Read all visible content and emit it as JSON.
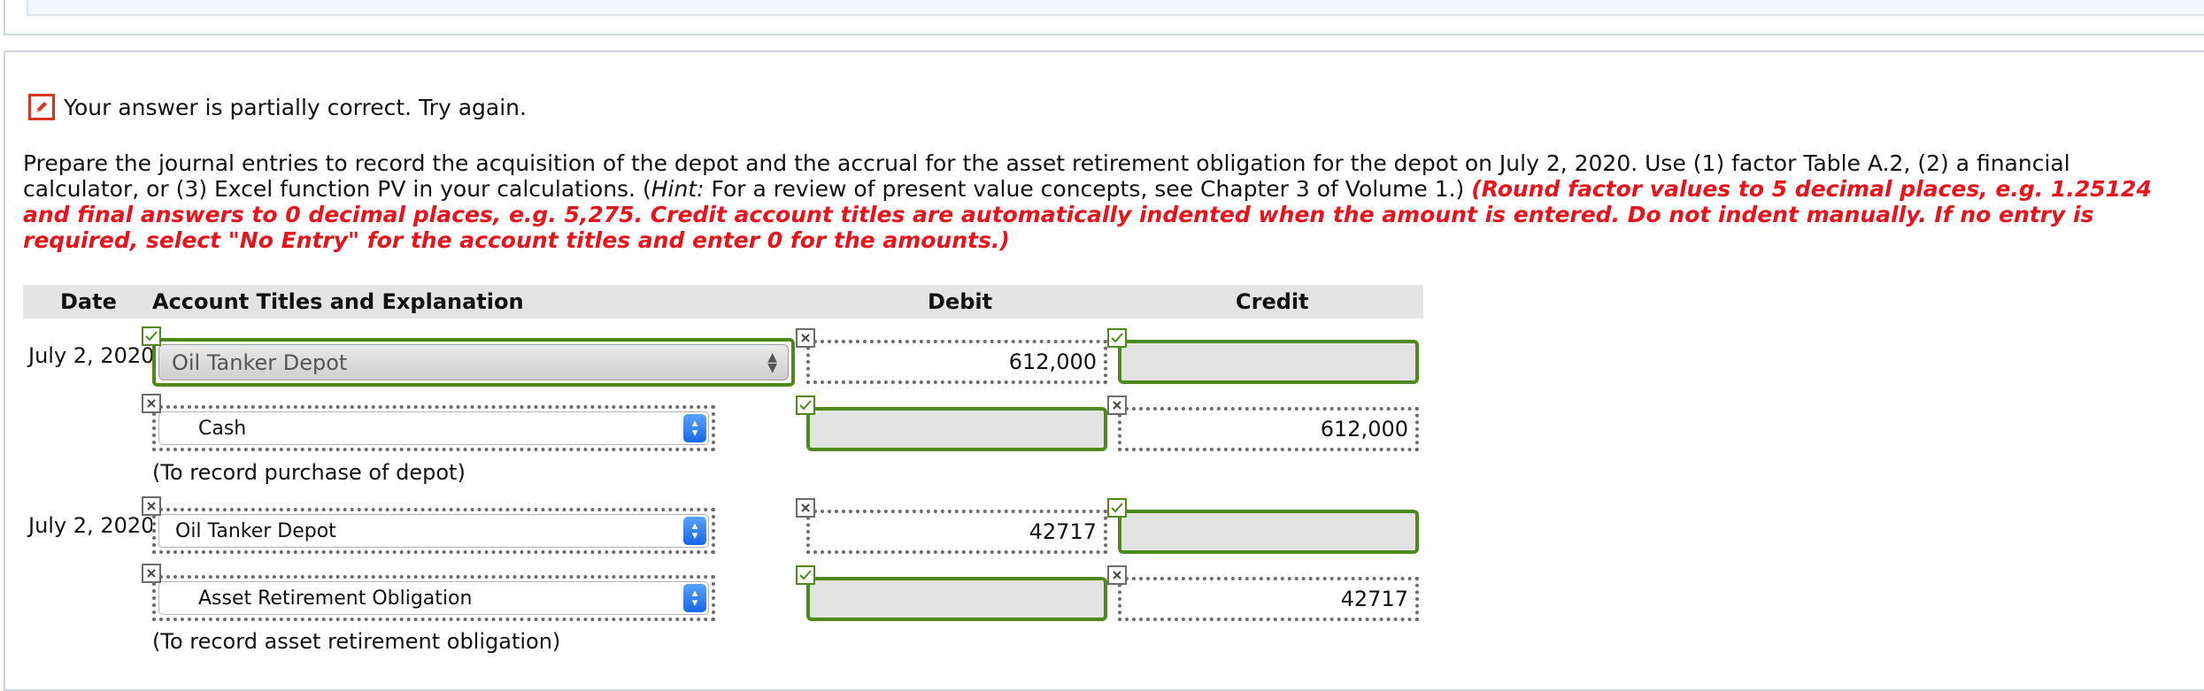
{
  "feedback": {
    "status_text": "Your answer is partially correct.  Try again."
  },
  "instructions": {
    "part1": "Prepare the journal entries to record the acquisition of the depot and the accrual for the asset retirement obligation for the depot on July 2, 2020. Use (1) factor Table A.2, (2) a financial calculator, or (3) Excel function PV in your calculations. (",
    "hint_label": "Hint:",
    "part2": " For a review of present value concepts, see Chapter 3 of Volume 1.) ",
    "red_text": "(Round factor values to 5 decimal places, e.g. 1.25124 and final answers to 0 decimal places, e.g. 5,275. Credit account titles are automatically indented when the amount is entered. Do not indent manually. If no entry is required, select \"No Entry\" for the account titles and enter 0 for the amounts.)"
  },
  "table": {
    "headers": {
      "date": "Date",
      "account": "Account Titles and Explanation",
      "debit": "Debit",
      "credit": "Credit"
    },
    "entries": [
      {
        "date": "July 2, 2020",
        "lines": [
          {
            "account": "Oil Tanker Depot",
            "debit": "612,000",
            "credit": ""
          },
          {
            "account": "Cash",
            "debit": "",
            "credit": "612,000"
          }
        ],
        "memo": "(To record purchase of depot)"
      },
      {
        "date": "July 2, 2020",
        "lines": [
          {
            "account": "Oil Tanker Depot",
            "debit": "42717",
            "credit": ""
          },
          {
            "account": "Asset Retirement Obligation",
            "debit": "",
            "credit": "42717"
          }
        ],
        "memo": "(To record asset retirement obligation)"
      }
    ]
  },
  "colors": {
    "correct": "#4e8a1b",
    "incorrect": "#6b6b6b",
    "emphasis_red": "#e8141c",
    "feedback_icon": "#d9331f"
  },
  "icons": {
    "feedback": "pencil-icon",
    "correct": "check-icon",
    "incorrect": "x-icon",
    "dropdown": "chevron-updown-icon"
  }
}
